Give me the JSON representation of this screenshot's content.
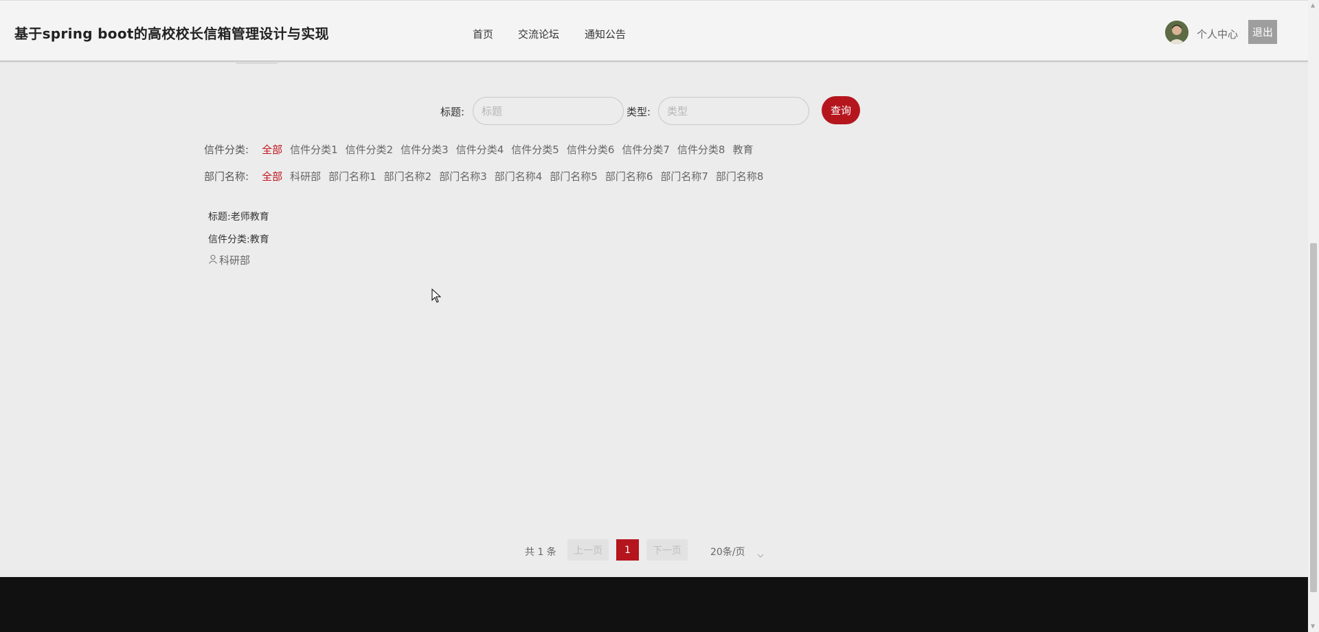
{
  "header": {
    "site_title": "基于spring boot的高校校长信箱管理设计与实现",
    "nav": [
      "首页",
      "交流论坛",
      "通知公告"
    ],
    "user_center": "个人中心",
    "logout": "退出"
  },
  "search": {
    "title_label": "标题:",
    "title_placeholder": "标题",
    "type_label": "类型:",
    "type_placeholder": "类型",
    "query_button": "查询"
  },
  "filters": {
    "category_label": "信件分类:",
    "categories": [
      "全部",
      "信件分类1",
      "信件分类2",
      "信件分类3",
      "信件分类4",
      "信件分类5",
      "信件分类6",
      "信件分类7",
      "信件分类8",
      "教育"
    ],
    "department_label": "部门名称:",
    "departments": [
      "全部",
      "科研部",
      "部门名称1",
      "部门名称2",
      "部门名称3",
      "部门名称4",
      "部门名称5",
      "部门名称6",
      "部门名称7",
      "部门名称8"
    ]
  },
  "item": {
    "title": "标题:老师教育",
    "category": "信件分类:教育",
    "department": "科研部"
  },
  "pagination": {
    "total": "共 1 条",
    "prev": "上一页",
    "current_page": "1",
    "next": "下一页",
    "page_size": "20条/页"
  },
  "colors": {
    "accent": "#b5161e",
    "active_filter": "#c0141d",
    "footer": "#111111",
    "background": "#ececec"
  }
}
